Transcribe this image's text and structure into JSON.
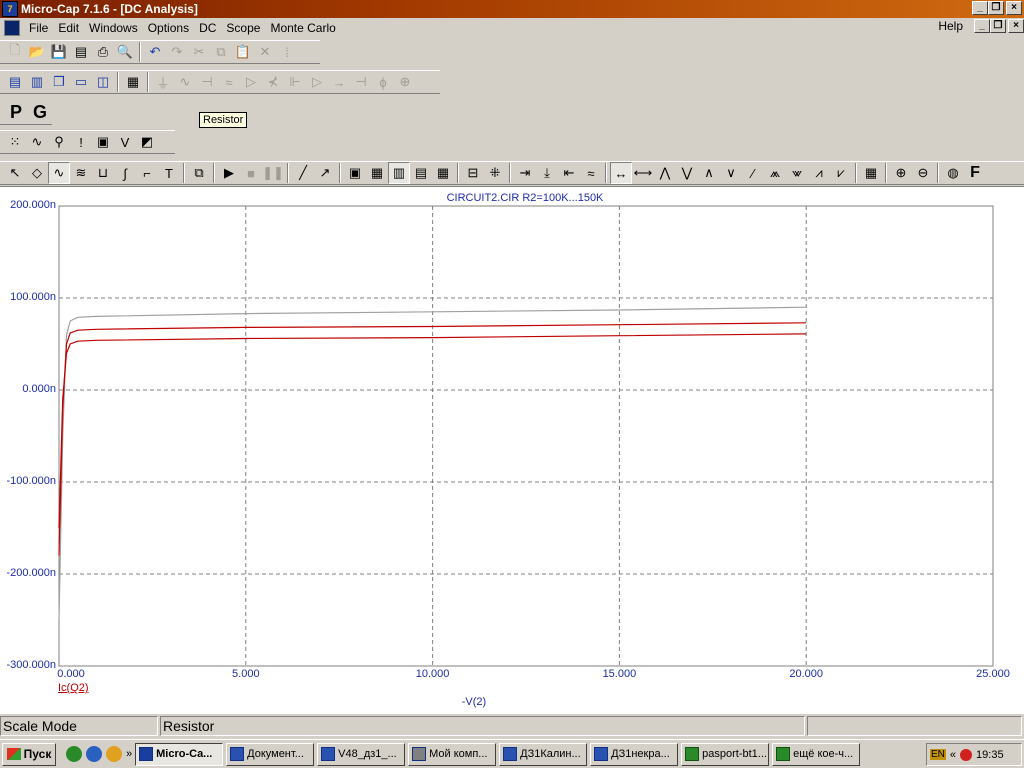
{
  "window": {
    "title": "Micro-Cap 7.1.6 - [DC Analysis]",
    "app_icon_text": "7"
  },
  "menu": {
    "items": [
      "File",
      "Edit",
      "Windows",
      "Options",
      "DC",
      "Scope",
      "Monte Carlo"
    ],
    "help": "Help"
  },
  "toolbar_row3": {
    "p_label": "P",
    "g_label": "G"
  },
  "tooltip": "Resistor",
  "chart_data": {
    "type": "line",
    "title": "CIRCUIT2.CIR R2=100K...150K",
    "xlabel": "-V(2)",
    "ylabel": "Ic(Q2)",
    "xlim": [
      0,
      25
    ],
    "ylim": [
      -300,
      200
    ],
    "x_ticks": [
      "0.000",
      "5.000",
      "10.000",
      "15.000",
      "20.000",
      "25.000"
    ],
    "y_ticks": [
      "200.000n",
      "100.000n",
      "0.000n",
      "-100.000n",
      "-200.000n",
      "-300.000n"
    ],
    "grid": true,
    "series": [
      {
        "color": "#a0a0a0",
        "points": [
          [
            0,
            -250
          ],
          [
            0.1,
            -50
          ],
          [
            0.2,
            60
          ],
          [
            0.3,
            75
          ],
          [
            0.5,
            79
          ],
          [
            1,
            80
          ],
          [
            5,
            83
          ],
          [
            10,
            85
          ],
          [
            15,
            87
          ],
          [
            20,
            90
          ]
        ]
      },
      {
        "color": "#c00000",
        "points": [
          [
            0,
            -180
          ],
          [
            0.1,
            -20
          ],
          [
            0.2,
            50
          ],
          [
            0.3,
            62
          ],
          [
            0.5,
            65
          ],
          [
            1,
            66
          ],
          [
            5,
            68
          ],
          [
            10,
            69
          ],
          [
            15,
            71
          ],
          [
            20,
            73
          ]
        ]
      },
      {
        "color": "#c00000",
        "points": [
          [
            0,
            -150
          ],
          [
            0.1,
            -10
          ],
          [
            0.2,
            40
          ],
          [
            0.3,
            50
          ],
          [
            0.5,
            53
          ],
          [
            1,
            54
          ],
          [
            5,
            56
          ],
          [
            10,
            57
          ],
          [
            15,
            59
          ],
          [
            20,
            61
          ]
        ]
      }
    ]
  },
  "status": {
    "mode": "Scale Mode",
    "hint": "Resistor"
  },
  "taskbar": {
    "start": "Пуск",
    "tasks": [
      "Micro-Ca...",
      "Документ...",
      "V48_дз1_...",
      "Мой комп...",
      "ДЗ1Калин...",
      "ДЗ1некра...",
      "pasport-bt1...",
      "ещё кое-ч..."
    ],
    "lang": "EN",
    "arrows": "«",
    "clock": "19:35"
  }
}
